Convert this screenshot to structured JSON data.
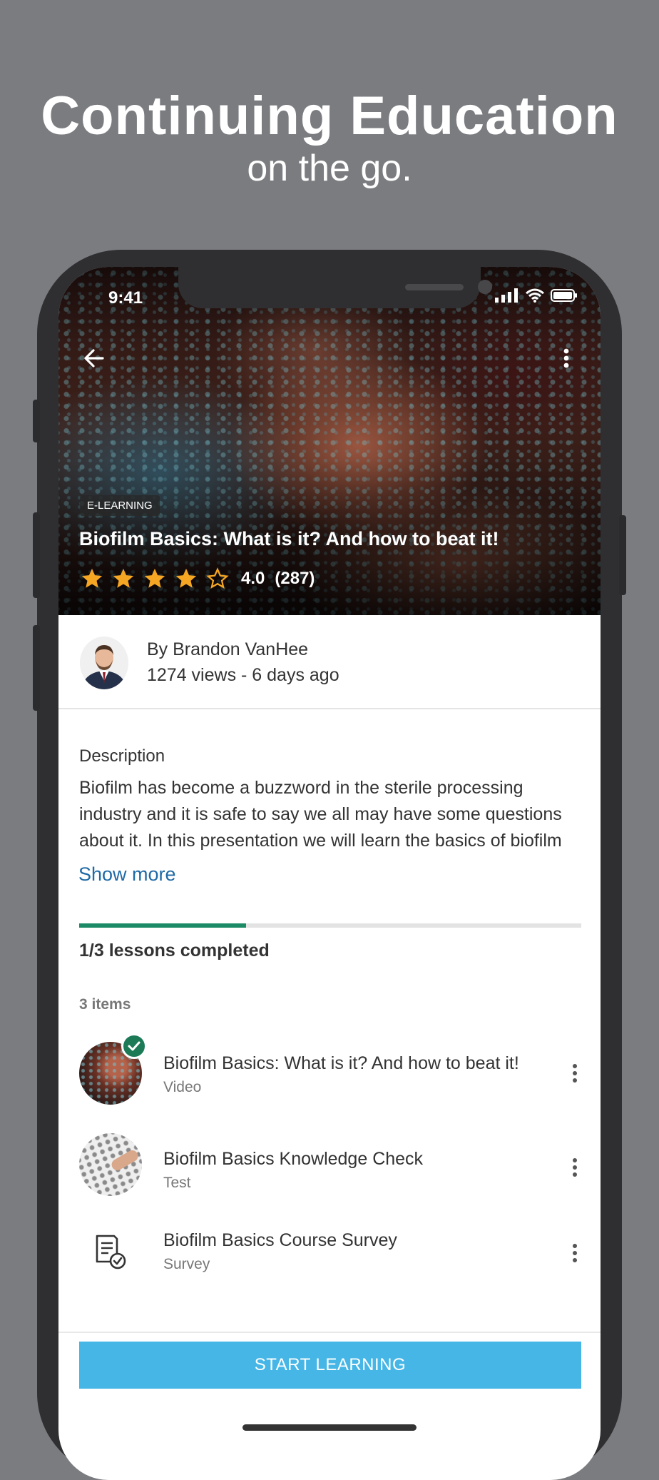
{
  "promo": {
    "headline": "Continuing Education",
    "subline": "on the go."
  },
  "status_bar": {
    "time": "9:41",
    "icons": [
      "signal-icon",
      "wifi-icon",
      "battery-icon"
    ]
  },
  "hero": {
    "badge": "E-LEARNING",
    "title": "Biofilm Basics: What is it? And how to beat it!",
    "rating_value": "4.0",
    "rating_count": "(287)",
    "stars_filled": 4,
    "stars_total": 5,
    "star_color": "#f5a623"
  },
  "author": {
    "name": "By Brandon VanHee",
    "meta": "1274 views - 6 days ago"
  },
  "description": {
    "label": "Description",
    "text": "Biofilm has become a buzzword in the sterile processing industry and it is safe to say we all may have some questions about it. In this presentation we will learn the basics of biofilm",
    "show_more": "Show more"
  },
  "progress": {
    "completed": 1,
    "total": 3,
    "fraction": 0.333,
    "label": "1/3 lessons completed",
    "color": "#1c8a66"
  },
  "lessons": {
    "count_label": "3 items",
    "items": [
      {
        "title": "Biofilm Basics: What is it? And how to beat it!",
        "type": "Video",
        "completed": true
      },
      {
        "title": "Biofilm Basics Knowledge Check",
        "type": "Test",
        "completed": false
      },
      {
        "title": "Biofilm Basics Course Survey",
        "type": "Survey",
        "completed": false
      }
    ]
  },
  "cta": {
    "label": "START LEARNING",
    "color": "#45b6e6"
  }
}
